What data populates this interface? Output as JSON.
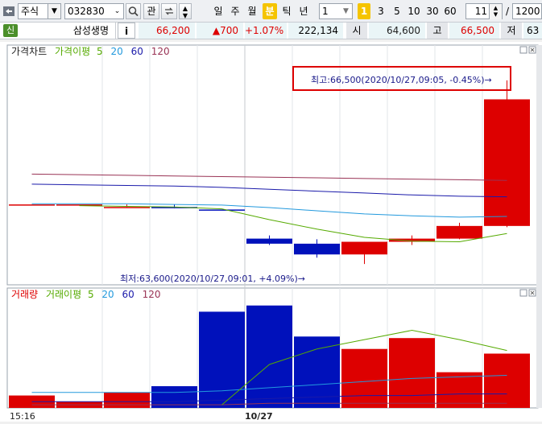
{
  "toolbar": {
    "type_select": "주식",
    "code": "032830",
    "btn_gwan": "관",
    "period_tabs": [
      "일",
      "주",
      "월",
      "분",
      "틱",
      "년"
    ],
    "selected_period": "분",
    "interval_value": "1",
    "interval_buttons": [
      "1",
      "3",
      "5",
      "10",
      "30",
      "60"
    ],
    "selected_interval": "1",
    "count_value": "11",
    "slash": "/",
    "total_count": "1200"
  },
  "infobar": {
    "badge": "신",
    "name": "삼성생명",
    "info_button": "i",
    "price": "66,200",
    "change": "▲700",
    "change_pct": "+1.07%",
    "volume": "222,134",
    "label_open": "시",
    "open": "64,600",
    "label_high": "고",
    "high": "66,500",
    "label_low": "저",
    "low_partial": "63"
  },
  "price_panel": {
    "legend": {
      "title": "가격차트",
      "ma_label": "가격이평",
      "ma_periods": [
        "5",
        "20",
        "60",
        "120"
      ]
    },
    "high_annotation": "최고:66,500(2020/10/27,09:05, -0.45%)→",
    "low_annotation": "최저:63,600(2020/10/27,09:01, +4.09%)→"
  },
  "volume_panel": {
    "legend": {
      "title": "거래량",
      "ma_label": "거래이평",
      "ma_periods": [
        "5",
        "20",
        "60",
        "120"
      ]
    }
  },
  "time_axis": {
    "labels": [
      "15:16",
      "10/27"
    ]
  },
  "colors": {
    "up": "#dd0000",
    "down": "#0011bb",
    "ma5": "#55aa00",
    "ma20": "#2299dd",
    "ma60": "#1a1aaa",
    "ma120": "#993355",
    "highlight_box": "#dd0000",
    "selected_tab": "#f5c400"
  },
  "chart_data": {
    "type": "candlestick",
    "candles": [
      {
        "open": 64540,
        "high": 64540,
        "low": 64540,
        "close": 64540,
        "dir": "up"
      },
      {
        "open": 64540,
        "high": 64540,
        "low": 64540,
        "close": 64540,
        "dir": "up"
      },
      {
        "open": 64500,
        "high": 64540,
        "low": 64500,
        "close": 64500,
        "dir": "up"
      },
      {
        "open": 64500,
        "high": 64540,
        "low": 64480,
        "close": 64480,
        "dir": "down"
      },
      {
        "open": 64460,
        "high": 64460,
        "low": 64460,
        "close": 64460,
        "dir": "down"
      },
      {
        "open": 64000,
        "high": 64050,
        "low": 63900,
        "close": 63920,
        "dir": "down"
      },
      {
        "open": 63920,
        "high": 63990,
        "low": 63700,
        "close": 63750,
        "dir": "down"
      },
      {
        "open": 63750,
        "high": 63950,
        "low": 63600,
        "close": 63950,
        "dir": "up"
      },
      {
        "open": 63950,
        "high": 64050,
        "low": 63900,
        "close": 64000,
        "dir": "up"
      },
      {
        "open": 64000,
        "high": 64250,
        "low": 63990,
        "close": 64200,
        "dir": "up"
      },
      {
        "open": 64200,
        "high": 66500,
        "low": 64180,
        "close": 66200,
        "dir": "up"
      }
    ],
    "price_range": [
      63550,
      66600
    ],
    "ma_price": {
      "ma5": [
        null,
        64520,
        64510,
        64500,
        64470,
        64300,
        64150,
        64020,
        63960,
        63950,
        64080
      ],
      "ma20": [
        64550,
        64550,
        64550,
        64540,
        64530,
        64490,
        64440,
        64390,
        64360,
        64340,
        64350
      ],
      "ma60": [
        64860,
        64850,
        64840,
        64830,
        64810,
        64780,
        64750,
        64720,
        64690,
        64670,
        64660
      ],
      "ma120": [
        65020,
        65010,
        65000,
        64990,
        64980,
        64970,
        64960,
        64950,
        64940,
        64930,
        64920
      ]
    },
    "volumes": [
      8,
      4,
      10,
      14,
      62,
      66,
      46,
      38,
      45,
      23,
      35
    ],
    "volume_range": [
      0,
      70
    ],
    "ma_volume": {
      "ma5": [
        null,
        null,
        null,
        null,
        2,
        28,
        38,
        44,
        50,
        44,
        37
      ],
      "ma20": [
        10,
        10,
        10,
        10,
        11,
        13,
        15,
        17,
        19,
        20,
        21
      ],
      "ma60": [
        4,
        4,
        4,
        4,
        5,
        6,
        7,
        8,
        8,
        9,
        9
      ],
      "ma120": [
        2,
        2,
        2,
        2,
        2,
        3,
        3,
        3,
        3,
        3,
        3
      ]
    }
  }
}
